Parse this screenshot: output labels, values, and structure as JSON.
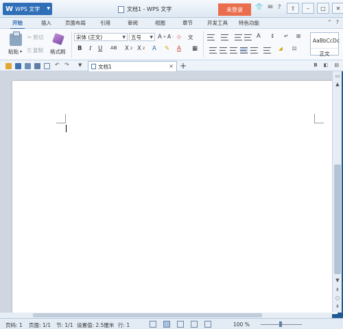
{
  "app": {
    "name": "WPS 文字",
    "title": "文档1 - WPS 文字",
    "login_label": "未登录"
  },
  "menu_tabs": [
    "开始",
    "插入",
    "页面布局",
    "引用",
    "审阅",
    "视图",
    "章节",
    "开发工具",
    "特色功能"
  ],
  "ribbon": {
    "paste": "粘贴",
    "cut": "剪切",
    "copy": "复制",
    "format_painter": "格式刷",
    "font_name": "宋体 (正文)",
    "font_size": "五号",
    "style_sample": "AaBbCcDc",
    "style_name": "正文"
  },
  "doc_tab": {
    "label": "文档1"
  },
  "status": {
    "page": "页码: 1",
    "pages": "页面: 1/1",
    "section": "节: 1/1",
    "position": "设置值: 2.5厘米",
    "line": "行: 1",
    "zoom": "100 %"
  },
  "colors": {
    "accent": "#2a66b3",
    "login": "#ea6e4d",
    "app_button": "#2f6fb8"
  }
}
